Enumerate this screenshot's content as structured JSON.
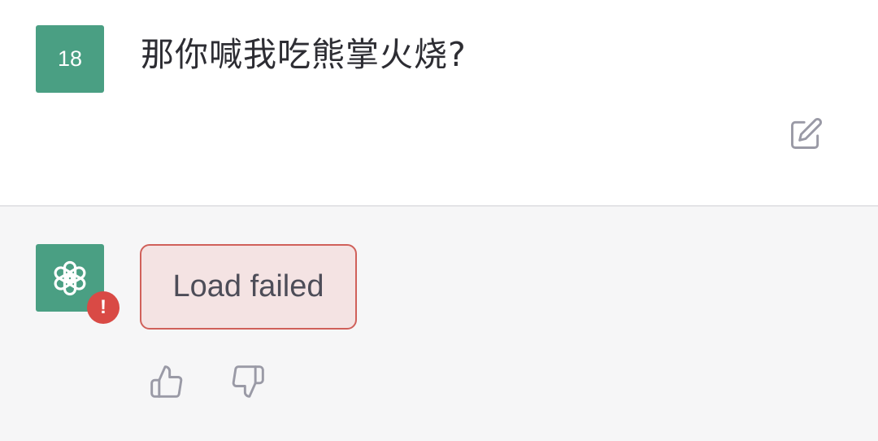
{
  "conversation": {
    "user_message": {
      "avatar_text": "18",
      "text": "那你喊我吃熊掌火烧?",
      "edit_icon": "edit-icon"
    },
    "assistant_message": {
      "avatar_icon": "openai-logo-icon",
      "error_badge": "!",
      "error_text": "Load failed",
      "feedback": {
        "like_icon": "thumbs-up-icon",
        "dislike_icon": "thumbs-down-icon"
      }
    }
  },
  "colors": {
    "avatar_bg": "#4a9f83",
    "error_border": "#d0605a",
    "error_bg": "#f4e3e3",
    "error_badge": "#d94a45",
    "assistant_row_bg": "#f6f6f7",
    "icon_gray": "#9a9aa6"
  }
}
